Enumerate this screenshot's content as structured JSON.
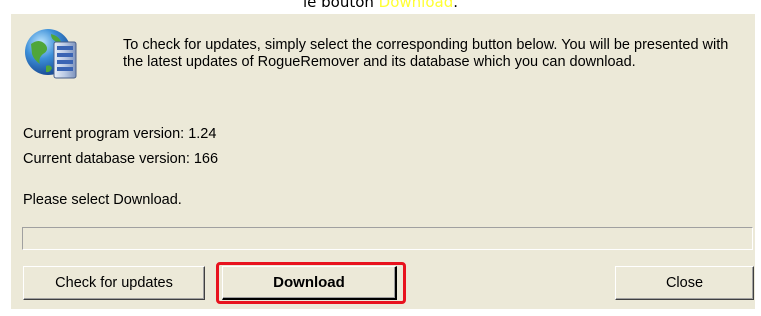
{
  "caption": {
    "prefix": "le bouton ",
    "highlight": "Download",
    "suffix": "."
  },
  "dialog": {
    "intro_text": "To check for updates, simply select the corresponding button below. You will be presented with the latest updates of RogueRemover and its database which you can download.",
    "program_version": "Current program version: 1.24",
    "database_version": "Current database version: 166",
    "status": "Please select Download.",
    "progress": 0,
    "buttons": {
      "check": "Check for updates",
      "download": "Download",
      "close": "Close"
    },
    "colors": {
      "highlight_box": "#e8121e",
      "caption_highlight": "#ffff33",
      "dialog_bg": "#ece9d8"
    },
    "icon": "globe-server-icon"
  }
}
